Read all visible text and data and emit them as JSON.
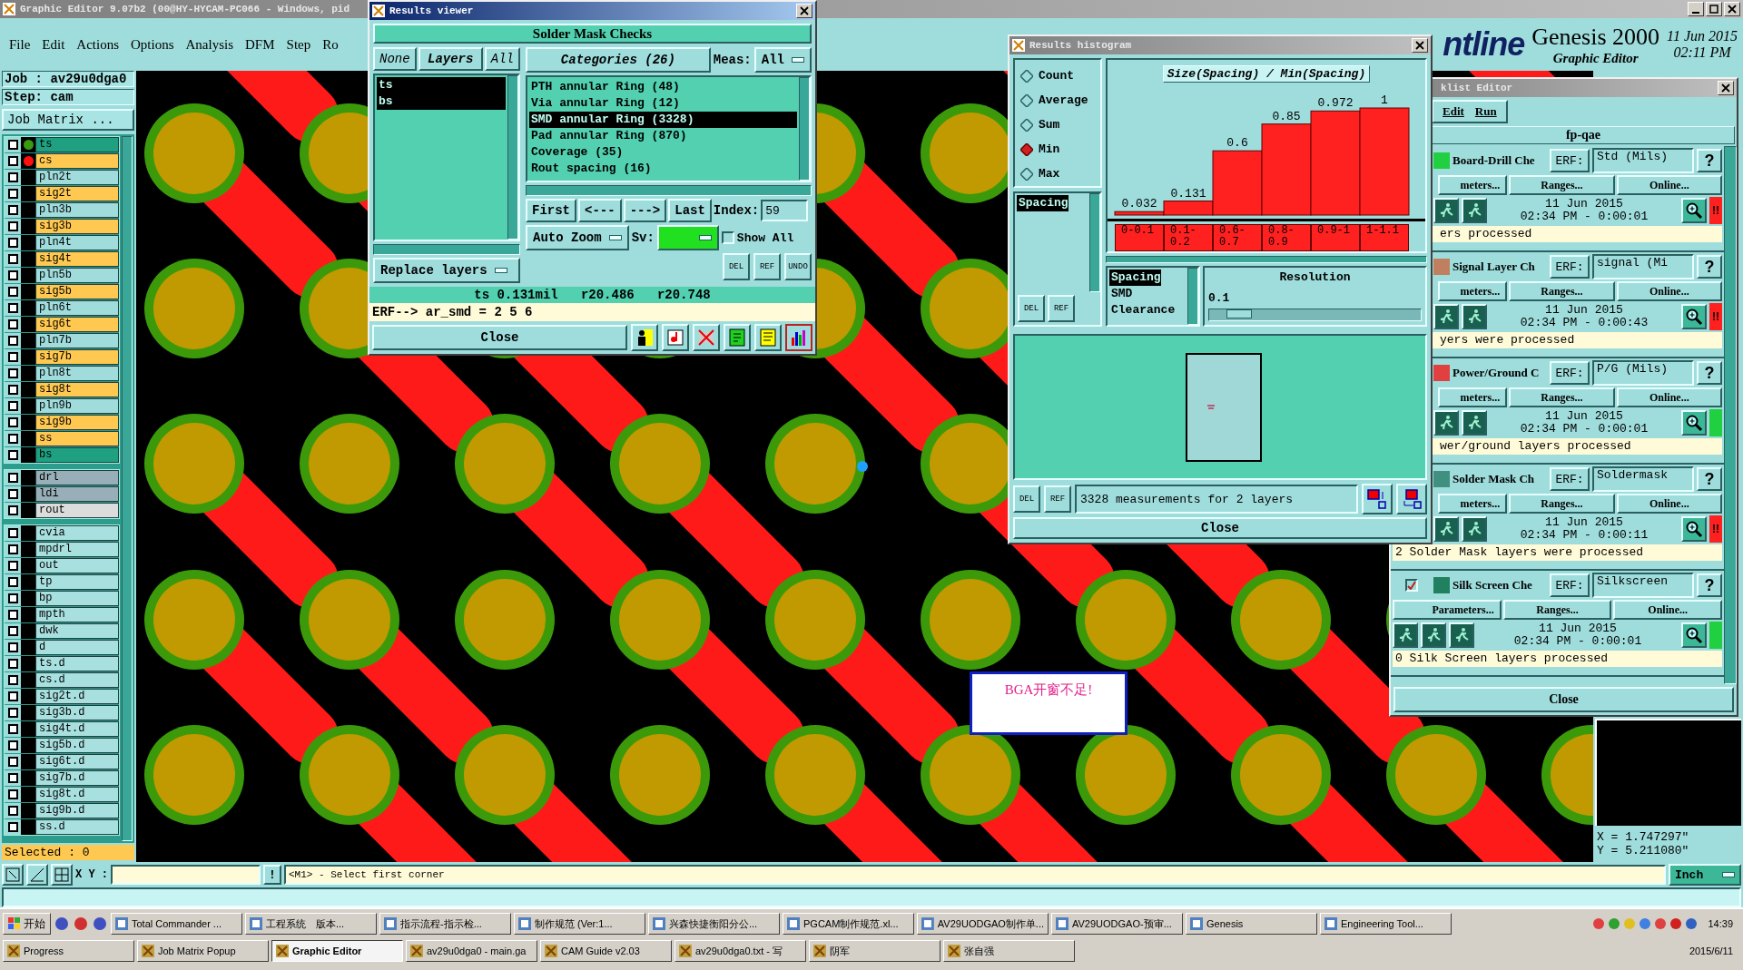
{
  "main_window": {
    "title": "Graphic Editor 9.07b2 (00@HY-HYCAM-PC066 - Windows, pid"
  },
  "menu": [
    "File",
    "Edit",
    "Actions",
    "Options",
    "Analysis",
    "DFM",
    "Step",
    "Ro"
  ],
  "header": {
    "logo": "ntline",
    "product": "Genesis 2000",
    "subtitle": "Graphic Editor",
    "date": "11 Jun 2015",
    "time": "02:11 PM"
  },
  "job": {
    "job": "Job : av29u0dga0",
    "step": "Step: cam",
    "matrix_button": "Job Matrix ..."
  },
  "layer_groups": [
    [
      {
        "name": "ts",
        "color": "#1fa080",
        "checked": false,
        "dot": {
          "color": "#3a9a10"
        }
      },
      {
        "name": "cs",
        "color": "#ffc850",
        "checked": false,
        "dot": {
          "color": "#ff1010"
        }
      },
      {
        "name": "pln2t",
        "color": "#a0dcdc",
        "checked": false
      },
      {
        "name": "sig2t",
        "color": "#ffc850",
        "checked": false
      },
      {
        "name": "pln3b",
        "color": "#a0dcdc",
        "checked": false
      },
      {
        "name": "sig3b",
        "color": "#ffc850",
        "checked": false
      },
      {
        "name": "pln4t",
        "color": "#a0dcdc",
        "checked": false
      },
      {
        "name": "sig4t",
        "color": "#ffc850",
        "checked": false
      },
      {
        "name": "pln5b",
        "color": "#a0dcdc",
        "checked": false
      },
      {
        "name": "sig5b",
        "color": "#ffc850",
        "checked": false
      },
      {
        "name": "pln6t",
        "color": "#a0dcdc",
        "checked": false
      },
      {
        "name": "sig6t",
        "color": "#ffc850",
        "checked": false
      },
      {
        "name": "pln7b",
        "color": "#a0dcdc",
        "checked": false
      },
      {
        "name": "sig7b",
        "color": "#ffc850",
        "checked": false
      },
      {
        "name": "pln8t",
        "color": "#a0dcdc",
        "checked": false
      },
      {
        "name": "sig8t",
        "color": "#ffc850",
        "checked": false
      },
      {
        "name": "pln9b",
        "color": "#a0dcdc",
        "checked": false
      },
      {
        "name": "sig9b",
        "color": "#ffc850",
        "checked": false
      },
      {
        "name": "ss",
        "color": "#ffc850",
        "checked": false
      },
      {
        "name": "bs",
        "color": "#1fa080",
        "checked": false
      }
    ],
    [
      {
        "name": "drl",
        "color": "#98aeb8",
        "checked": false
      },
      {
        "name": "ldi",
        "color": "#98aeb8",
        "checked": false
      },
      {
        "name": "rout",
        "color": "#dcdcdc",
        "checked": false
      }
    ],
    [
      {
        "name": "cvia",
        "color": "#a8e0e0",
        "checked": false
      },
      {
        "name": "mpdrl",
        "color": "#a8e0e0",
        "checked": false
      },
      {
        "name": "out",
        "color": "#a8e0e0",
        "checked": false
      },
      {
        "name": "tp",
        "color": "#a8e0e0",
        "checked": false
      },
      {
        "name": "bp",
        "color": "#a8e0e0",
        "checked": false
      },
      {
        "name": "mpth",
        "color": "#a8e0e0",
        "checked": false
      },
      {
        "name": "dwk",
        "color": "#a8e0e0",
        "checked": false
      },
      {
        "name": "d",
        "color": "#a8e0e0",
        "checked": false
      },
      {
        "name": "ts.d",
        "color": "#a8e0e0",
        "checked": false
      },
      {
        "name": "cs.d",
        "color": "#a8e0e0",
        "checked": false
      },
      {
        "name": "sig2t.d",
        "color": "#a8e0e0",
        "checked": false
      },
      {
        "name": "sig3b.d",
        "color": "#a8e0e0",
        "checked": false
      },
      {
        "name": "sig4t.d",
        "color": "#a8e0e0",
        "checked": false
      },
      {
        "name": "sig5b.d",
        "color": "#a8e0e0",
        "checked": false
      },
      {
        "name": "sig6t.d",
        "color": "#a8e0e0",
        "checked": false
      },
      {
        "name": "sig7b.d",
        "color": "#a8e0e0",
        "checked": false
      },
      {
        "name": "sig8t.d",
        "color": "#a8e0e0",
        "checked": false
      },
      {
        "name": "sig9b.d",
        "color": "#a8e0e0",
        "checked": false
      },
      {
        "name": "ss.d",
        "color": "#a8e0e0",
        "checked": false
      }
    ]
  ],
  "selected_count": "Selected : 0",
  "bga_note": "BGA开窗不足!",
  "coordinates": {
    "x": "X = 1.747297\"",
    "y": "Y = 5.211080\""
  },
  "command_bar": {
    "xy_label": "X Y :",
    "excl": "!",
    "prompt": "<M1> - Select first corner",
    "units": "Inch"
  },
  "results_viewer": {
    "title": "Results viewer",
    "heading": "Solder Mask Checks",
    "none": "None",
    "layers_label": "Layers",
    "all": "All",
    "layers": [
      {
        "name": "ts",
        "selected": true
      },
      {
        "name": "bs",
        "selected": true
      }
    ],
    "replace": "Replace layers",
    "categories_label": "Categories (26)",
    "meas_label": "Meas:",
    "meas": "All",
    "categories": [
      {
        "name": "PTH annular Ring (48)",
        "selected": false
      },
      {
        "name": "Via annular Ring (12)",
        "selected": false
      },
      {
        "name": "SMD annular Ring (3328)",
        "selected": true
      },
      {
        "name": "Pad annular Ring (870)",
        "selected": false
      },
      {
        "name": "Coverage (35)",
        "selected": false
      },
      {
        "name": "Rout spacing (16)",
        "selected": false
      }
    ],
    "nav": [
      "First",
      "<---",
      "--->",
      "Last"
    ],
    "index_label": "Index:",
    "index": "59",
    "zoom": "Auto Zoom",
    "sv_label": "Sv:",
    "sv": {
      "color": "#20e020"
    },
    "show_all": {
      "label": "Show All",
      "checked": false
    },
    "tools": [
      "DEL",
      "REF",
      "UNDO"
    ],
    "status": "ts 0.131mil   r20.486   r20.748",
    "erf": "ERF--> ar_smd = 2 5 6",
    "close": "Close"
  },
  "histogram": {
    "title": "Results histogram",
    "modes": [
      {
        "label": "Count",
        "selected": false
      },
      {
        "label": "Average",
        "selected": false
      },
      {
        "label": "Sum",
        "selected": false
      },
      {
        "label": "Min",
        "selected": true
      },
      {
        "label": "Max",
        "selected": false
      }
    ],
    "fields": [
      {
        "label": "Spacing",
        "selected": true
      }
    ],
    "tools": [
      "DEL",
      "REF"
    ],
    "chart_data": {
      "type": "bar",
      "title": "Size(Spacing) / Min(Spacing)",
      "categories": [
        "0-0.1",
        "0.1-0.2",
        "0.6-0.7",
        "0.8-0.9",
        "0.9-1",
        "1-1.1"
      ],
      "values": [
        0.032,
        0.131,
        0.6,
        0.85,
        0.972,
        1
      ],
      "data_labels": true
    },
    "measures": [
      {
        "label": "Spacing",
        "selected": true
      },
      {
        "label": "SMD",
        "selected": false
      },
      {
        "label": "Clearance",
        "selected": false
      }
    ],
    "resolution_label": "Resolution",
    "resolution": "0.1",
    "resolution_slider": {
      "level": 0.08
    },
    "bottom_tools": [
      "DEL",
      "REF"
    ],
    "summary": "3328 measurements for 2 layers",
    "close": "Close"
  },
  "checklist": {
    "title": "klist Editor",
    "menu": [
      "Edit",
      "Run"
    ],
    "name": "fp-qae",
    "rows": [
      {
        "kind": "covered",
        "name": "Board-Drill Che",
        "icon": {
          "color": "#20d040"
        },
        "erf_label": "ERF:",
        "erf": "Std (Mils)",
        "help": "?",
        "buttons": [
          "meters...",
          "Ranges...",
          "Online..."
        ],
        "date": "11 Jun 2015",
        "time": "02:34 PM - 0:00:01",
        "status": {
          "color": "#ff2020",
          "flag": "!!"
        },
        "message": {
          "kind": "covered",
          "text": "ers processed"
        }
      },
      {
        "kind": "covered",
        "name": "Signal Layer Ch",
        "icon": {
          "color": "#c08060"
        },
        "erf_label": "ERF:",
        "erf": "signal (Mi",
        "help": "?",
        "buttons": [
          "meters...",
          "Ranges...",
          "Online..."
        ],
        "date": "11 Jun 2015",
        "time": "02:34 PM - 0:00:43",
        "status": {
          "color": "#ff2020",
          "flag": "!!"
        },
        "message": {
          "kind": "covered",
          "text": "yers were processed"
        }
      },
      {
        "kind": "covered",
        "name": "Power/Ground C",
        "icon": {
          "color": "#e04040"
        },
        "erf_label": "ERF:",
        "erf": "P/G (Mils)",
        "help": "?",
        "buttons": [
          "meters...",
          "Ranges...",
          "Online..."
        ],
        "date": "11 Jun 2015",
        "time": "02:34 PM - 0:00:01",
        "status": {
          "color": "#20d040"
        },
        "message": {
          "kind": "covered",
          "text": "wer/ground layers processed"
        }
      },
      {
        "kind": "covered",
        "name": "Solder Mask Ch",
        "icon": {
          "color": "#409080"
        },
        "erf_label": "ERF:",
        "erf": "Soldermask",
        "help": "?",
        "buttons": [
          "meters...",
          "Ranges...",
          "Online..."
        ],
        "date": "11 Jun 2015",
        "time": "02:34 PM - 0:00:11",
        "status": {
          "color": "#ff2020",
          "flag": "!!"
        },
        "message": {
          "kind": "full",
          "text": "2 Solder Mask layers were processed"
        }
      },
      {
        "kind": "full",
        "checked": true,
        "name": "Silk Screen Che",
        "icon": {
          "color": "#208060"
        },
        "erf_label": "ERF:",
        "erf": "Silkscreen",
        "help": "?",
        "buttons": [
          "Parameters...",
          "Ranges...",
          "Online..."
        ],
        "date": "11 Jun 2015",
        "time": "02:34 PM - 0:00:01",
        "status": {
          "color": "#20d040"
        },
        "message": {
          "kind": "full",
          "text": "0 Silk Screen layers processed"
        }
      }
    ],
    "close": "Close"
  },
  "taskbar": {
    "start": "开始",
    "tasks": [
      "Total Commander ...",
      "工程系统　版本...",
      "指示流程-指示检...",
      "制作规范 (Ver:1...",
      "兴森快捷衡阳分公...",
      "PGCAM制作规范.xl...",
      "AV29UODGAO制作单...",
      "AV29UODGAO-预审...",
      "Genesis",
      "Engineering Tool..."
    ],
    "windows": [
      {
        "label": "Progress",
        "selected": false
      },
      {
        "label": "Job Matrix Popup",
        "selected": false
      },
      {
        "label": "Graphic Editor",
        "selected": true
      },
      {
        "label": "av29u0dga0 - main.ga",
        "selected": false
      },
      {
        "label": "CAM Guide v2.03",
        "selected": false
      },
      {
        "label": "av29u0dga0.txt - 写",
        "selected": false
      },
      {
        "label": "阴军",
        "selected": false
      },
      {
        "label": "张自强",
        "selected": false
      }
    ],
    "time": "14:39",
    "date": "2015/6/11"
  }
}
